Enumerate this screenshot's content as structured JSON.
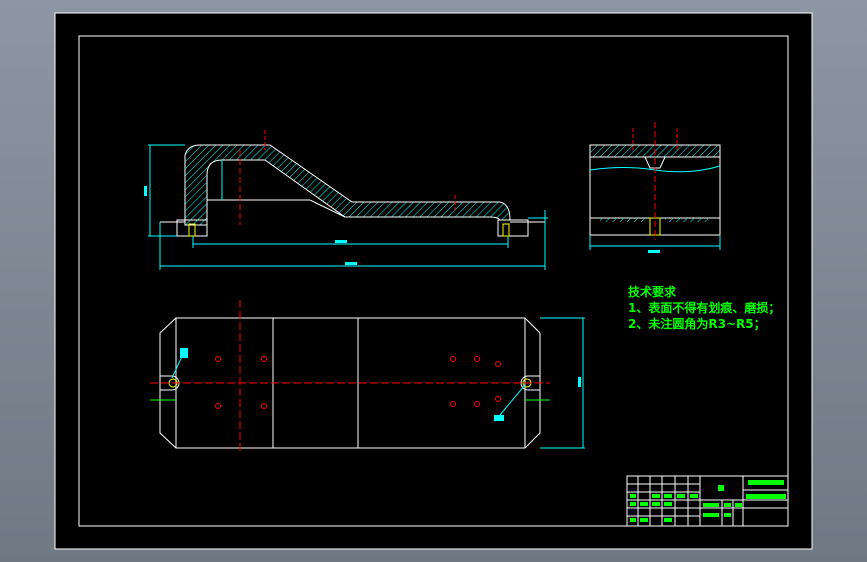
{
  "technical_requirements": {
    "title": "技术要求",
    "items": [
      "1、表面不得有划痕、磨损；",
      "2、未注圆角为R3~R5；"
    ]
  },
  "colors": {
    "background": "#000000",
    "outline": "#ffffff",
    "dimension": "#00ffff",
    "centerline": "#ff0000",
    "notes": "#00ff00",
    "hatch": "#00ffff"
  }
}
